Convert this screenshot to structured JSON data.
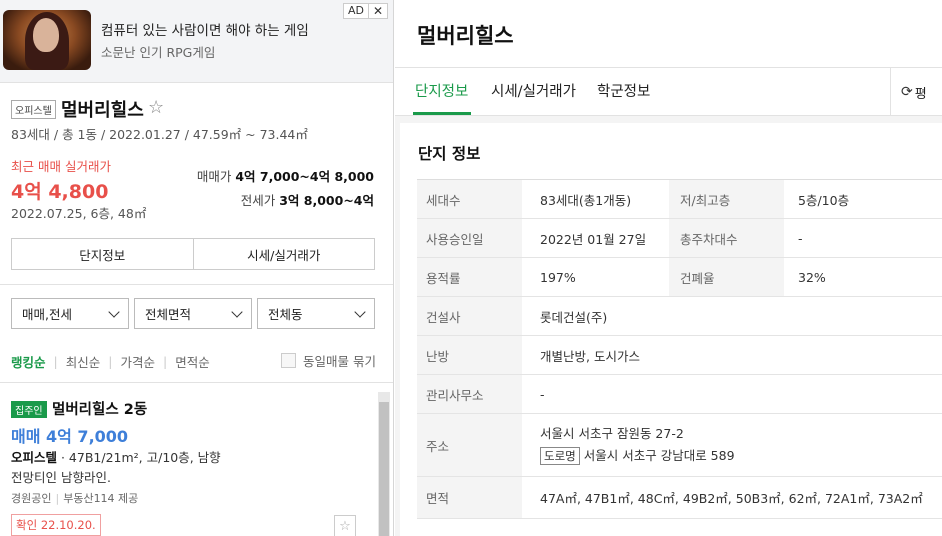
{
  "ad": {
    "title": "컴퓨터 있는 사람이면 해야 하는 게임",
    "subtitle": "소문난 인기 RPG게임",
    "badge": "AD",
    "close": "✕"
  },
  "complex": {
    "type_tag": "오피스텔",
    "name": "멀버리힐스",
    "star": "☆",
    "meta": "83세대 / 총 1동 / 2022.01.27 / 47.59㎡ ~ 73.44㎡",
    "recent_label": "최근 매매 실거래가",
    "recent_price": "4억 4,800",
    "recent_date": "2022.07.25, 6층, 48㎡",
    "sale_label": "매매가",
    "sale_range": "4억 7,000~4억 8,000",
    "jeonse_label": "전세가",
    "jeonse_range": "3억 8,000~4억"
  },
  "buttons": {
    "info": "단지정보",
    "price": "시세/실거래가"
  },
  "filters": [
    "매매,전세",
    "전체면적",
    "전체동"
  ],
  "sort": {
    "items": [
      "랭킹순",
      "최신순",
      "가격순",
      "면적순"
    ],
    "same_listing": "동일매물 묶기"
  },
  "listing": {
    "tag": "집주인",
    "name": "멀버리힐스 2동",
    "price": "매매 4억 7,000",
    "spec_type": "오피스텔",
    "spec_rest": " · 47B1/21m², 고/10층, 남향",
    "desc": "전망티인 남향라인.",
    "agent": "경원공인",
    "agent_src": "부동산114 제공",
    "confirm": "확인 22.10.20.",
    "star": "☆"
  },
  "detail": {
    "title": "멀버리힐스",
    "tabs": [
      "단지정보",
      "시세/실거래가",
      "학군정보"
    ],
    "tab_right": "평",
    "section_title": "단지 정보",
    "rows": {
      "households_k": "세대수",
      "households_v": "83세대(총1개동)",
      "floors_k": "저/최고층",
      "floors_v": "5층/10층",
      "approval_k": "사용승인일",
      "approval_v": "2022년 01월 27일",
      "parking_k": "총주차대수",
      "parking_v": "-",
      "far_k": "용적률",
      "far_v": "197%",
      "bcr_k": "건폐율",
      "bcr_v": "32%",
      "builder_k": "건설사",
      "builder_v": "롯데건설(주)",
      "heating_k": "난방",
      "heating_v": "개별난방, 도시가스",
      "office_k": "관리사무소",
      "office_v": "-",
      "address_k": "주소",
      "address_v": "서울시 서초구 잠원동 27-2",
      "road_tag": "도로명",
      "road_v": "서울시 서초구 강남대로 589",
      "area_k": "면적",
      "area_v": "47A㎡, 47B1㎡, 48C㎡, 49B2㎡, 50B3㎡, 62㎡, 72A1㎡, 73A2㎡"
    }
  }
}
